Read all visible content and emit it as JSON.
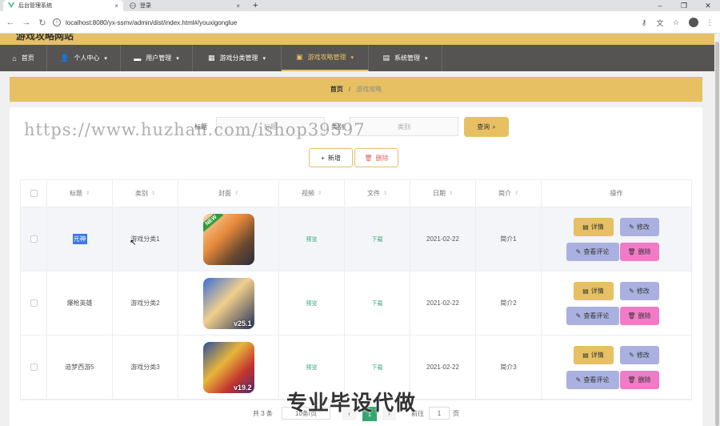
{
  "browser": {
    "tabs": [
      {
        "title": "后台管理系统",
        "active": true
      },
      {
        "title": "登录",
        "active": false
      }
    ],
    "new_tab": "+",
    "url": "localhost:8080/yx-ssmv/admin/dist/index.html#/youxigonglue",
    "win_minimize": "–",
    "win_restore": "❐",
    "win_close": "✕"
  },
  "app": {
    "brand": "游戏攻略网站",
    "nav": [
      {
        "label": "首页",
        "icon": "home-icon"
      },
      {
        "label": "个人中心",
        "icon": "user-icon"
      },
      {
        "label": "用户管理",
        "icon": "briefcase-icon"
      },
      {
        "label": "游戏分类管理",
        "icon": "grid-icon"
      },
      {
        "label": "游戏攻略管理",
        "icon": "book-icon",
        "active": true
      },
      {
        "label": "系统管理",
        "icon": "document-icon"
      }
    ]
  },
  "breadcrumb": {
    "home": "首页",
    "separator": "/",
    "current": "游戏攻略"
  },
  "search": {
    "title_label": "标题",
    "title_placeholder": "标题",
    "category_label": "类别",
    "category_placeholder": "类别",
    "query_button": "查询"
  },
  "actions": {
    "add_button": "新增",
    "delete_button": "删除"
  },
  "table": {
    "columns": [
      "标题",
      "类别",
      "封面",
      "视频",
      "文件",
      "日期",
      "简介",
      "操作"
    ],
    "rows": [
      {
        "title": "元神",
        "category": "游戏分类1",
        "cover_badge": "NEW",
        "video": "预览",
        "file": "下载",
        "date": "2021-02-22",
        "intro": "简介1"
      },
      {
        "title": "爆枪英雄",
        "category": "游戏分类2",
        "cover_badge": "v25.1",
        "video": "预览",
        "file": "下载",
        "date": "2021-02-22",
        "intro": "简介2"
      },
      {
        "title": "造梦西游5",
        "category": "游戏分类3",
        "cover_badge": "v19.2",
        "video": "预览",
        "file": "下载",
        "date": "2021-02-22",
        "intro": "简介3"
      }
    ],
    "op_labels": {
      "detail": "详情",
      "edit": "修改",
      "review": "查看评论",
      "delete": "删除"
    }
  },
  "pagination": {
    "total": "共 3 条",
    "page_size": "10条/页",
    "prev": "‹",
    "current": "1",
    "next": "›",
    "goto_prefix": "前往",
    "goto_value": "1",
    "goto_suffix": "页"
  },
  "overlay": {
    "watermark": "https://www.huzhan.com/ishop39397",
    "bottom_text": "专业毕设代做"
  },
  "colors": {
    "accent": "#e6c063",
    "nav_bg": "#555452",
    "edit_btn": "#aab1e0",
    "delete_btn": "#f07cc8",
    "link_green": "#35a66f"
  }
}
